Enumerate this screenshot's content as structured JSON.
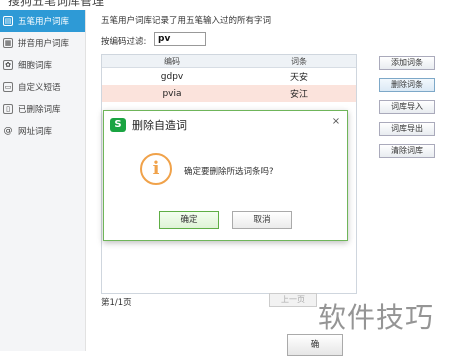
{
  "window": {
    "title": "搜狗五笔词库管理"
  },
  "sidebar": {
    "items": [
      {
        "label": "五笔用户词库",
        "icon": "wubi-dict-icon",
        "glyph": "▤",
        "active": true
      },
      {
        "label": "拼音用户词库",
        "icon": "pinyin-dict-icon",
        "glyph": "▦",
        "active": false
      },
      {
        "label": "细胞词库",
        "icon": "cell-dict-icon",
        "glyph": "✿",
        "active": false
      },
      {
        "label": "自定义短语",
        "icon": "phrase-icon",
        "glyph": "▭",
        "active": false
      },
      {
        "label": "已删除词库",
        "icon": "trash-icon",
        "glyph": "▯",
        "active": false
      },
      {
        "label": "网址词库",
        "icon": "at-icon",
        "glyph": "@",
        "active": false
      }
    ]
  },
  "main": {
    "description": "五笔用户词库记录了用五笔输入过的所有字词",
    "filter_label": "按编码过滤:",
    "filter_value": "pv",
    "table": {
      "headers": [
        "编码",
        "词条"
      ],
      "rows": [
        {
          "code": "gdpv",
          "word": "天安",
          "selected": false
        },
        {
          "code": "pvia",
          "word": "安江",
          "selected": true
        }
      ]
    },
    "buttons": {
      "add": "添加词条",
      "delete": "删除词条",
      "import": "词库导入",
      "export": "词库导出",
      "clear": "清除词库"
    },
    "page_info": "第1/1页",
    "prev_page": "上一页",
    "ok_partial": "确"
  },
  "dialog": {
    "title": "删除自造词",
    "logo_glyph": "S",
    "close_glyph": "×",
    "info_glyph": "i",
    "message": "确定要删除所选词条吗?",
    "confirm": "确定",
    "cancel": "取消"
  },
  "watermark": "软件技巧",
  "colors": {
    "accent": "#2e9ad6",
    "selected_row": "#fbe3dc",
    "dialog_border": "#6fb55a",
    "logo_green": "#1aa442",
    "info_orange": "#f0a24a"
  }
}
